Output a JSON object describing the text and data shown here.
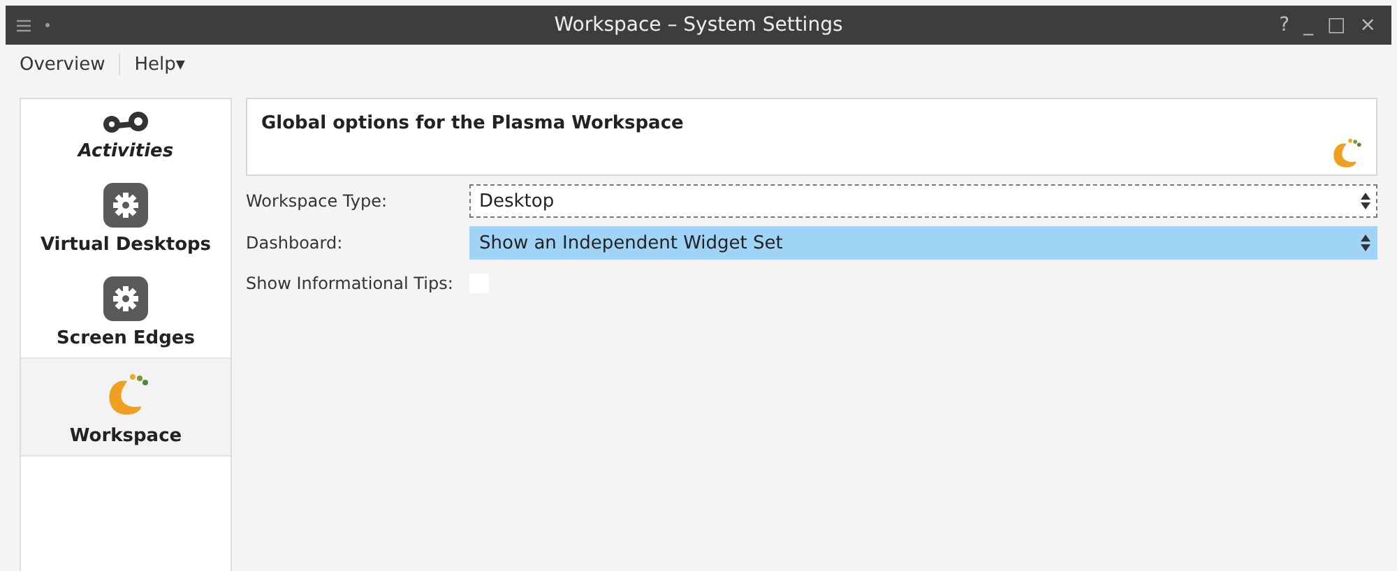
{
  "window": {
    "title": "Workspace – System Settings",
    "buttons": [
      "?",
      "_",
      "□",
      "×"
    ]
  },
  "menu": [
    "Overview",
    "Help▾"
  ],
  "sidebar": {
    "items": [
      {
        "label": "Activities",
        "selected": false
      },
      {
        "label": "Virtual Desktops",
        "selected": false
      },
      {
        "label": "Screen Edges",
        "selected": false
      },
      {
        "label": "Workspace",
        "selected": true
      }
    ]
  },
  "header": {
    "title": "Global options for the Plasma Workspace"
  },
  "settings": [
    {
      "kind": "combo",
      "label": "Workspace Type:",
      "value": "Desktop",
      "focused": true,
      "highlighted": false
    },
    {
      "kind": "combo",
      "label": "Dashboard:",
      "value": "Show an Independent Widget Set",
      "focused": false,
      "highlighted": true
    },
    {
      "kind": "checkbox",
      "label": "Show Informational Tips:",
      "checked": false
    }
  ]
}
